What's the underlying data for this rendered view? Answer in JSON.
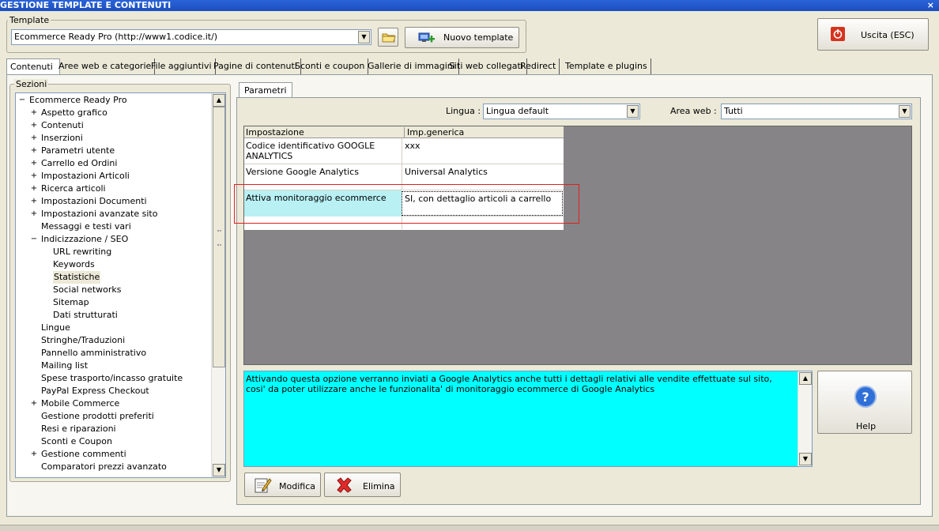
{
  "window": {
    "title": "GESTIONE TEMPLATE E CONTENUTI",
    "close": "×"
  },
  "template": {
    "group_label": "Template",
    "selected": "Ecommerce Ready Pro (http://www1.codice.it/)",
    "new_label": "Nuovo template"
  },
  "exit_label": "Uscita (ESC)",
  "tabs": [
    "Contenuti",
    "Aree web e categorie",
    "File aggiuntivi",
    "Pagine di contenuti",
    "Sconti e coupon",
    "Gallerie di immagini",
    "Siti web collegati",
    "Redirect",
    "Template e plugins"
  ],
  "sections": {
    "label": "Sezioni",
    "root": "Ecommerce Ready Pro",
    "items": [
      {
        "label": "Aspetto grafico",
        "exp": "+",
        "level": 1
      },
      {
        "label": "Contenuti",
        "exp": "+",
        "level": 1
      },
      {
        "label": "Inserzioni",
        "exp": "+",
        "level": 1
      },
      {
        "label": "Parametri utente",
        "exp": "+",
        "level": 1
      },
      {
        "label": "Carrello ed Ordini",
        "exp": "+",
        "level": 1
      },
      {
        "label": "Impostazioni Articoli",
        "exp": "+",
        "level": 1
      },
      {
        "label": "Ricerca articoli",
        "exp": "+",
        "level": 1
      },
      {
        "label": "Impostazioni Documenti",
        "exp": "+",
        "level": 1
      },
      {
        "label": "Impostazioni avanzate sito",
        "exp": "+",
        "level": 1
      },
      {
        "label": "Messaggi e testi vari",
        "exp": "",
        "level": 1
      },
      {
        "label": "Indicizzazione / SEO",
        "exp": "−",
        "level": 1
      },
      {
        "label": "URL rewriting",
        "exp": "",
        "level": 2
      },
      {
        "label": "Keywords",
        "exp": "",
        "level": 2
      },
      {
        "label": "Statistiche",
        "exp": "",
        "level": 2,
        "selected": true
      },
      {
        "label": "Social networks",
        "exp": "",
        "level": 2
      },
      {
        "label": "Sitemap",
        "exp": "",
        "level": 2
      },
      {
        "label": "Dati strutturati",
        "exp": "",
        "level": 2
      },
      {
        "label": "Lingue",
        "exp": "",
        "level": 1
      },
      {
        "label": "Stringhe/Traduzioni",
        "exp": "",
        "level": 1
      },
      {
        "label": "Pannello amministrativo",
        "exp": "",
        "level": 1
      },
      {
        "label": "Mailing list",
        "exp": "",
        "level": 1
      },
      {
        "label": "Spese trasporto/incasso gratuite",
        "exp": "",
        "level": 1
      },
      {
        "label": "PayPal Express Checkout",
        "exp": "",
        "level": 1
      },
      {
        "label": "Mobile Commerce",
        "exp": "+",
        "level": 1
      },
      {
        "label": "Gestione prodotti preferiti",
        "exp": "",
        "level": 1
      },
      {
        "label": "Resi e riparazioni",
        "exp": "",
        "level": 1
      },
      {
        "label": "Sconti e Coupon",
        "exp": "",
        "level": 1
      },
      {
        "label": "Gestione commenti",
        "exp": "+",
        "level": 1
      },
      {
        "label": "Comparatori prezzi avanzato",
        "exp": "",
        "level": 1
      }
    ]
  },
  "params": {
    "tab": "Parametri",
    "lingua_label": "Lingua :",
    "lingua_value": "Lingua default",
    "area_label": "Area web :",
    "area_value": "Tutti",
    "columns": [
      "Impostazione",
      "Imp.generica"
    ],
    "rows": [
      {
        "name": "Codice identificativo GOOGLE ANALYTICS",
        "value": "xxx"
      },
      {
        "name": "Versione Google Analytics",
        "value": "Universal Analytics"
      },
      {
        "name": "Attiva monitoraggio ecommerce",
        "value": "SI, con dettaglio articoli a carrello"
      },
      {
        "name": "",
        "value": ""
      }
    ],
    "description": "Attivando questa opzione verranno inviati a Google Analytics anche tutti i dettagli relativi alle vendite effettuate sul sito, cosi' da poter utilizzare anche le funzionalita' di monitoraggio ecommerce di Google Analytics",
    "help_label": "Help",
    "modify_label": "Modifica",
    "delete_label": "Elimina"
  }
}
